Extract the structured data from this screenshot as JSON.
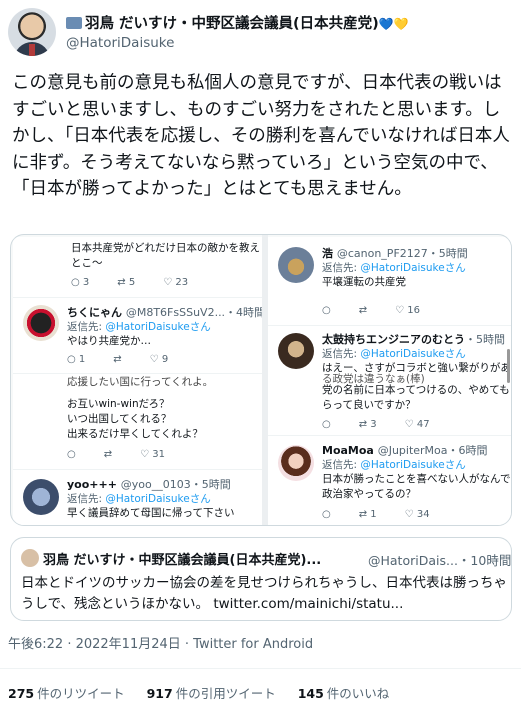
{
  "author": {
    "name": "羽鳥 だいすけ・中野区議会議員(日本共産党)",
    "hearts": "💙💛",
    "handle": "@HatoriDaisuke"
  },
  "tweet_text": "この意見も前の意見も私個人の意見ですが、日本代表の戦いはすごいと思いますし、ものすごい努力をされたと思います。しかし、「日本代表を応援し、その勝利を喜んでいなければ日本人に非ず。そう考えてないなら黙っていろ」という空気の中で、「日本が勝ってよかった」とはとても思えません。",
  "screenshot": {
    "left": {
      "top_text_1": "日本共産党がどれだけ日本の敵かを教え",
      "top_text_2": "とこ～",
      "top_actions": [
        "3",
        "5",
        "23"
      ],
      "chiku": {
        "name": "ちくにゃん",
        "handle": "@M8T6FsSSuV2...",
        "time": "・4時間",
        "reply_prefix": "返信先: ",
        "reply_to": "@HatoriDaisukeさん",
        "text": "やはり共産党か…",
        "actions": [
          "1",
          "",
          "9"
        ]
      },
      "mid_text_0": "応援したい国に行ってくれよ。",
      "mid_text_1": "お互いwin-winだろ？",
      "mid_text_2": "いつ出国してくれる？",
      "mid_text_3": "出来るだけ早くしてくれよ？",
      "mid_actions": [
        "",
        "",
        "31"
      ],
      "yoo": {
        "name": "yoo+++",
        "handle": "@yoo__0103",
        "time": "・5時間",
        "reply_prefix": "返信先: ",
        "reply_to": "@HatoriDaisukeさん",
        "text": "早く議員辞めて母国に帰って下さい"
      }
    },
    "right": {
      "hiro": {
        "name": "浩",
        "handle": "@canon_PF2127",
        "time": "・5時間",
        "reply_prefix": "返信先: ",
        "reply_to": "@HatoriDaisukeさん",
        "text": "平壌運転の共産党",
        "actions": [
          "",
          "",
          "16"
        ]
      },
      "taiko": {
        "name": "太鼓持ちエンジニアのむとう",
        "time": "・5時間",
        "reply_prefix": "返信先: ",
        "reply_to": "@HatoriDaisukeさん",
        "text_1": "はえー、さすがコラボと強い繋がりがあ",
        "text_2": "る政党は違うなぁ(棒)",
        "text_3": "党の名前に日本ってつけるの、やめてもら",
        "text_4": "らって良いですか？",
        "actions": [
          "3",
          "47",
          ""
        ]
      },
      "moa": {
        "name": "MoaMoa",
        "handle": "@JupiterMoa",
        "time": "・6時間",
        "reply_prefix": "返信先: ",
        "reply_to": "@HatoriDaisukeさん",
        "text_1": "日本が勝ったことを喜べない人がなんで",
        "text_2": "政治家やってるの？",
        "actions": [
          "1",
          "34",
          ""
        ]
      }
    }
  },
  "quote": {
    "name": "羽鳥 だいすけ・中野区議会議員(日本共産党)...",
    "handle": "@HatoriDais...",
    "time": "・10時間",
    "text": "日本とドイツのサッカー協会の差を見せつけられちゃうし、日本代表は勝っちゃうしで、残念というほかない。 twitter.com/mainichi/statu..."
  },
  "meta": "午後6:22 · 2022年11月24日 · Twitter for Android",
  "stats": {
    "retweets_count": "275",
    "retweets_label": "件のリツイート",
    "quotes_count": "917",
    "quotes_label": "件の引用ツイート",
    "likes_count": "145",
    "likes_label": "件のいいね"
  }
}
